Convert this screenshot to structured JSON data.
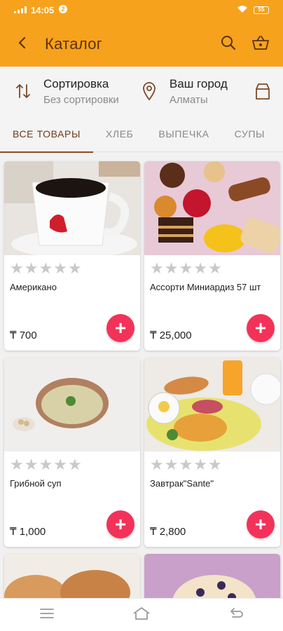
{
  "status_bar": {
    "signal": "▐▐",
    "time": "14:05",
    "battery": "55"
  },
  "appbar": {
    "title": "Каталог"
  },
  "filters": {
    "sort": {
      "title": "Сортировка",
      "value": "Без сортировки"
    },
    "city": {
      "title": "Ваш город",
      "value": "Алматы"
    }
  },
  "tabs": [
    "ВСЕ ТОВАРЫ",
    "ХЛЕБ",
    "ВЫПЕЧКА",
    "СУПЫ"
  ],
  "products": [
    {
      "name": "Американо",
      "price": "₸ 700",
      "rating": 0
    },
    {
      "name": "Ассорти Миниардиз 57 шт",
      "price": "₸ 25,000",
      "rating": 0
    },
    {
      "name": "Грибной суп",
      "price": "₸ 1,000",
      "rating": 0
    },
    {
      "name": "Завтрак\"Sante\"",
      "price": "₸ 2,800",
      "rating": 0
    }
  ],
  "add_symbol": "+",
  "star_glyph": "★",
  "icons": {
    "back": "arrow-left-icon",
    "search": "search-icon",
    "cart": "basket-icon",
    "sort": "sort-arrows-icon",
    "city": "location-pin-icon",
    "menu": "menu-icon",
    "home": "home-icon",
    "back_nav": "back-icon"
  },
  "colors": {
    "appbar": "#f7a21c",
    "title": "#5a3211",
    "accent": "#f3325a",
    "tab_active": "#6b3a1a"
  }
}
